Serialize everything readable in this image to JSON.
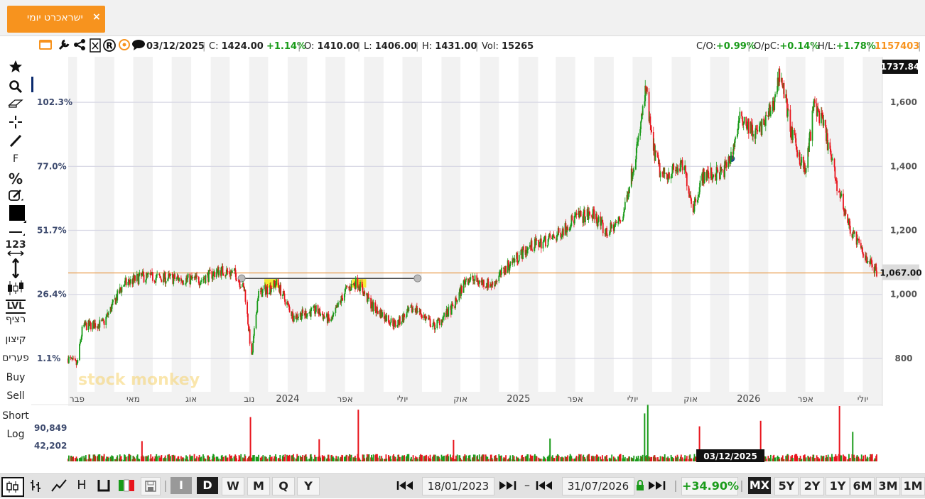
{
  "tab": {
    "label": "ישראכרט יומי",
    "close": "×"
  },
  "toolbar": {
    "icons": [
      "chart-logo-icon",
      "window-icon",
      "wrench-icon",
      "share-icon",
      "excel-icon",
      "registered-icon",
      "target-icon",
      "comment-icon"
    ]
  },
  "info": {
    "date": "03/12/2025",
    "close_label": "C:",
    "close": "1424.00",
    "change": "+1.14%",
    "open_label": "O:",
    "open": "1410.00",
    "low_label": "L:",
    "low": "1406.00",
    "high_label": "H:",
    "high": "1431.00",
    "vol_label": "Vol:",
    "vol": "15265",
    "co_label": "C/O:",
    "co": "+0.99%",
    "opc_label": "O/pC:",
    "opc": "+0.14%",
    "hl_label": "H/L:",
    "hl": "+1.78%",
    "id": "1157403"
  },
  "left_toolbar": {
    "f_label": "F",
    "pct_label": "%",
    "num_label": "123",
    "lvl_label": "LVL",
    "continuous": "רציף",
    "extreme": "קיצון",
    "gaps": "פערים",
    "buy": "Buy",
    "sell": "Sell",
    "short": "Short",
    "log": "Log"
  },
  "bottom": {
    "intervals": [
      "I",
      "D",
      "W",
      "M",
      "Q",
      "Y"
    ],
    "active_interval": "D",
    "start_date": "18/01/2023",
    "end_date": "31/07/2026",
    "range_change": "+34.90%",
    "ranges": [
      "MX",
      "5Y",
      "2Y",
      "1Y",
      "6M",
      "3M",
      "1M"
    ],
    "active_range": "MX",
    "dash": "–"
  },
  "colors": {
    "up": "#1a9b1a",
    "down": "#e8141c",
    "accent": "#f7931e",
    "hline": "#e89a4a"
  },
  "chart_data": {
    "type": "candlestick",
    "y_right_ticks": [
      800,
      1000,
      1200,
      1400,
      1600
    ],
    "y_left_ticks": [
      "1.1%",
      "26.4%",
      "51.7%",
      "77.0%",
      "102.3%"
    ],
    "ylim": [
      700,
      1737.84
    ],
    "last_price_label": "1,067.00",
    "top_label": "1737.84",
    "horizontal_line": 1067,
    "x_labels": [
      "פבר",
      "מאי",
      "אוג",
      "נוב",
      "2024",
      "אפר",
      "יולי",
      "אוק",
      "2025",
      "אפר",
      "יולי",
      "אוק",
      "2026",
      "אפר",
      "יולי"
    ],
    "x_label_dates": [
      "2023-02",
      "2023-05",
      "2023-08",
      "2023-11",
      "2024-01",
      "2024-04",
      "2024-07",
      "2024-10",
      "2025-01",
      "2025-04",
      "2025-07",
      "2025-10",
      "2026-01",
      "2026-04",
      "2026-07"
    ],
    "price_path": [
      [
        "2023-01-18",
        800
      ],
      [
        "2023-02-01",
        780
      ],
      [
        "2023-02-10",
        900
      ],
      [
        "2023-03-15",
        910
      ],
      [
        "2023-04-15",
        1030
      ],
      [
        "2023-05-15",
        1055
      ],
      [
        "2023-07-01",
        1050
      ],
      [
        "2023-08-15",
        1045
      ],
      [
        "2023-09-15",
        1075
      ],
      [
        "2023-10-10",
        1065
      ],
      [
        "2023-10-25",
        1010
      ],
      [
        "2023-11-05",
        800
      ],
      [
        "2023-11-15",
        1000
      ],
      [
        "2023-12-15",
        1035
      ],
      [
        "2024-01-10",
        930
      ],
      [
        "2024-02-15",
        950
      ],
      [
        "2024-03-10",
        915
      ],
      [
        "2024-04-01",
        1010
      ],
      [
        "2024-04-20",
        1040
      ],
      [
        "2024-05-15",
        960
      ],
      [
        "2024-06-20",
        905
      ],
      [
        "2024-07-20",
        960
      ],
      [
        "2024-08-20",
        900
      ],
      [
        "2024-09-20",
        960
      ],
      [
        "2024-10-10",
        1050
      ],
      [
        "2024-11-20",
        1030
      ],
      [
        "2024-12-20",
        1100
      ],
      [
        "2025-01-20",
        1150
      ],
      [
        "2025-03-01",
        1180
      ],
      [
        "2025-04-01",
        1240
      ],
      [
        "2025-05-01",
        1250
      ],
      [
        "2025-05-20",
        1190
      ],
      [
        "2025-06-15",
        1240
      ],
      [
        "2025-07-10",
        1480
      ],
      [
        "2025-07-22",
        1640
      ],
      [
        "2025-08-01",
        1470
      ],
      [
        "2025-08-15",
        1370
      ],
      [
        "2025-09-20",
        1400
      ],
      [
        "2025-10-05",
        1270
      ],
      [
        "2025-10-20",
        1370
      ],
      [
        "2025-11-20",
        1380
      ],
      [
        "2025-12-03",
        1424
      ],
      [
        "2025-12-20",
        1560
      ],
      [
        "2026-01-10",
        1500
      ],
      [
        "2026-01-25",
        1530
      ],
      [
        "2026-02-10",
        1600
      ],
      [
        "2026-02-20",
        1700
      ],
      [
        "2026-03-10",
        1500
      ],
      [
        "2026-04-01",
        1380
      ],
      [
        "2026-04-15",
        1600
      ],
      [
        "2026-05-01",
        1520
      ],
      [
        "2026-05-20",
        1350
      ],
      [
        "2026-06-10",
        1210
      ],
      [
        "2026-07-01",
        1130
      ],
      [
        "2026-07-25",
        1067
      ]
    ],
    "volume_ticks": [
      "42,202",
      "90,849"
    ],
    "volume_ylim": [
      0,
      150000
    ],
    "volume_spikes": [
      [
        "2023-11-03",
        120000,
        "down"
      ],
      [
        "2024-04-22",
        140000,
        "down"
      ],
      [
        "2025-07-20",
        130000,
        "up"
      ],
      [
        "2025-07-25",
        155000,
        "up"
      ],
      [
        "2025-10-15",
        95000,
        "down"
      ],
      [
        "2026-01-20",
        110000,
        "down"
      ],
      [
        "2026-05-25",
        150000,
        "down"
      ],
      [
        "2023-05-15",
        55000,
        "down"
      ],
      [
        "2024-02-20",
        60000,
        "down"
      ],
      [
        "2024-09-20",
        58000,
        "down"
      ],
      [
        "2025-02-20",
        62000,
        "up"
      ],
      [
        "2026-06-15",
        80000,
        "up"
      ]
    ],
    "crosshair_date_label": "03/12/2025",
    "watermark": "stock monkey"
  }
}
